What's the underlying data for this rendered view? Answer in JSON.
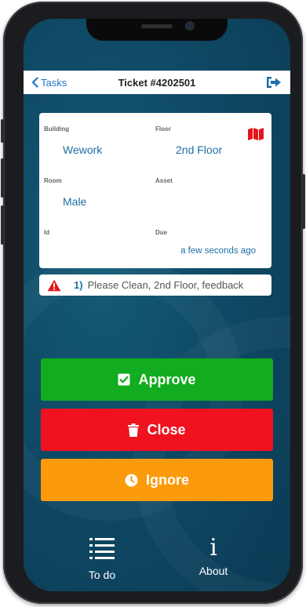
{
  "nav": {
    "back_label": "Tasks",
    "title": "Ticket #4202501",
    "logout_icon": "sign-out-icon"
  },
  "details": {
    "building_label": "Building",
    "building_value": "Wework",
    "floor_label": "Floor",
    "floor_value": "2nd Floor",
    "room_label": "Room",
    "room_value": "Male",
    "asset_label": "Asset",
    "asset_value": "",
    "id_label": "Id",
    "id_value": "",
    "due_label": "Due",
    "due_value": "a few seconds ago",
    "map_icon": "map-icon"
  },
  "issue": {
    "number": "1)",
    "text": "Please Clean, 2nd Floor, feedback",
    "icon": "warning-icon"
  },
  "actions": {
    "approve_label": "Approve",
    "close_label": "Close",
    "ignore_label": "Ignore"
  },
  "tabs": {
    "todo_label": "To do",
    "about_label": "About",
    "about_glyph": "i"
  },
  "colors": {
    "approve": "#11ac1f",
    "close": "#f0121f",
    "ignore": "#fb9a0a",
    "accent": "#1d6fa5",
    "background": "#0f4a66"
  }
}
